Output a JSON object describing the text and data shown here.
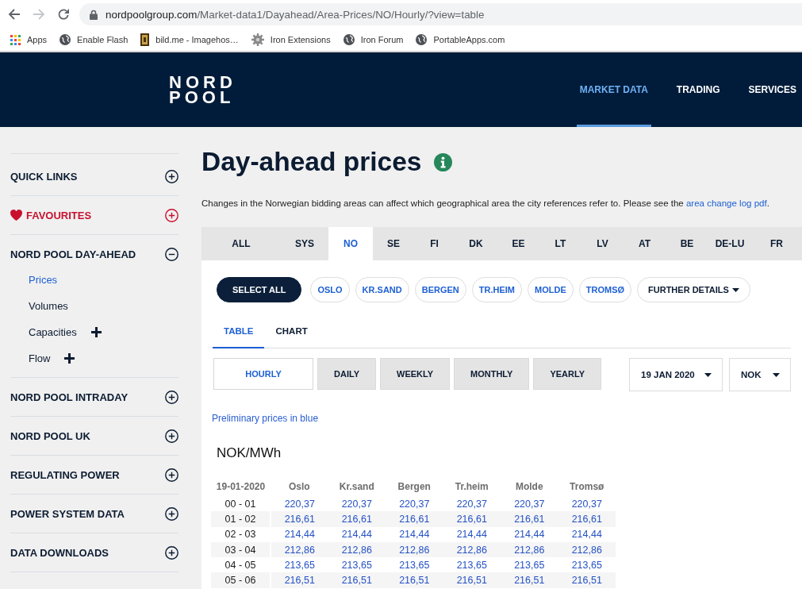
{
  "browser": {
    "nav_buttons": [
      {
        "kind": "back",
        "disabled": false
      },
      {
        "kind": "forward",
        "disabled": true
      },
      {
        "kind": "reload",
        "disabled": false
      }
    ],
    "url_host": "nordpoolgroup.com",
    "url_path": "/Market-data1/Dayahead/Area-Prices/NO/Hourly/?view=table",
    "bookmarks": [
      {
        "kind": "apps",
        "label": "Apps"
      },
      {
        "kind": "globe",
        "label": "Enable Flash"
      },
      {
        "kind": "thumbnail",
        "label": "bild.me - Imagehos…"
      },
      {
        "kind": "gear",
        "label": "Iron Extensions"
      },
      {
        "kind": "globe",
        "label": "Iron Forum"
      },
      {
        "kind": "globe",
        "label": "PortableApps.com"
      }
    ]
  },
  "header": {
    "logo": [
      "NORD",
      "POOL"
    ],
    "nav": [
      {
        "label": "MARKET DATA",
        "selected": true
      },
      {
        "label": "TRADING",
        "selected": false
      },
      {
        "label": "SERVICES",
        "selected": false
      }
    ]
  },
  "sidebar": {
    "sections": [
      {
        "label": "QUICK LINKS",
        "kind": "section",
        "expanded": false
      },
      {
        "label": "FAVOURITES",
        "kind": "favourite",
        "expanded": false
      },
      {
        "label": "NORD POOL DAY-AHEAD",
        "kind": "section",
        "expanded": true,
        "children": [
          {
            "label": "Prices",
            "selected": true,
            "expandable": false
          },
          {
            "label": "Volumes",
            "selected": false,
            "expandable": false
          },
          {
            "label": "Capacities",
            "selected": false,
            "expandable": true
          },
          {
            "label": "Flow",
            "selected": false,
            "expandable": true
          }
        ]
      },
      {
        "label": "NORD POOL INTRADAY",
        "kind": "section",
        "expanded": false
      },
      {
        "label": "NORD POOL UK",
        "kind": "section",
        "expanded": false
      },
      {
        "label": "REGULATING POWER",
        "kind": "section",
        "expanded": false
      },
      {
        "label": "POWER SYSTEM DATA",
        "kind": "section",
        "expanded": false
      },
      {
        "label": "DATA DOWNLOADS",
        "kind": "section",
        "expanded": false
      }
    ]
  },
  "page": {
    "title": "Day-ahead prices",
    "notice": {
      "text": "Changes in the Norwegian bidding areas can affect which geographical area the city references refer to. Please see the",
      "link": "area change log pdf",
      "end": "."
    }
  },
  "area_tabs": [
    {
      "label": "ALL",
      "selected": false
    },
    {
      "label": "SYS",
      "selected": false
    },
    {
      "label": "NO",
      "selected": true
    },
    {
      "label": "SE",
      "selected": false
    },
    {
      "label": "FI",
      "selected": false
    },
    {
      "label": "DK",
      "selected": false
    },
    {
      "label": "EE",
      "selected": false
    },
    {
      "label": "LT",
      "selected": false
    },
    {
      "label": "LV",
      "selected": false
    },
    {
      "label": "AT",
      "selected": false
    },
    {
      "label": "BE",
      "selected": false
    },
    {
      "label": "DE-LU",
      "selected": false
    },
    {
      "label": "FR",
      "selected": false
    }
  ],
  "city_filters": [
    {
      "label": "SELECT ALL",
      "kind": "select_all"
    },
    {
      "label": "OSLO",
      "kind": "city"
    },
    {
      "label": "KR.SAND",
      "kind": "city"
    },
    {
      "label": "BERGEN",
      "kind": "city"
    },
    {
      "label": "TR.HEIM",
      "kind": "city"
    },
    {
      "label": "MOLDE",
      "kind": "city"
    },
    {
      "label": "TROMSØ",
      "kind": "city"
    },
    {
      "label": "FURTHER DETAILS",
      "kind": "dropdown"
    }
  ],
  "view_tabs": [
    {
      "label": "TABLE",
      "selected": true
    },
    {
      "label": "CHART",
      "selected": false
    }
  ],
  "periods": [
    {
      "label": "HOURLY",
      "selected": true
    },
    {
      "label": "DAILY",
      "selected": false
    },
    {
      "label": "WEEKLY",
      "selected": false
    },
    {
      "label": "MONTHLY",
      "selected": false
    },
    {
      "label": "YEARLY",
      "selected": false
    }
  ],
  "date_select": {
    "value": "19 JAN 2020"
  },
  "currency_select": {
    "value": "NOK"
  },
  "legend_note": "Preliminary prices in blue",
  "unit": "NOK/MWh",
  "table": {
    "columns": [
      "19-01-2020",
      "Oslo",
      "Kr.sand",
      "Bergen",
      "Tr.heim",
      "Molde",
      "Tromsø"
    ],
    "rows": [
      {
        "hours": "00 - 01",
        "preliminary": true,
        "values": [
          "220,37",
          "220,37",
          "220,37",
          "220,37",
          "220,37",
          "220,37"
        ]
      },
      {
        "hours": "01 - 02",
        "preliminary": true,
        "values": [
          "216,61",
          "216,61",
          "216,61",
          "216,61",
          "216,61",
          "216,61"
        ]
      },
      {
        "hours": "02 - 03",
        "preliminary": true,
        "values": [
          "214,44",
          "214,44",
          "214,44",
          "214,44",
          "214,44",
          "214,44"
        ]
      },
      {
        "hours": "03 - 04",
        "preliminary": true,
        "values": [
          "212,86",
          "212,86",
          "212,86",
          "212,86",
          "212,86",
          "212,86"
        ]
      },
      {
        "hours": "04 - 05",
        "preliminary": true,
        "values": [
          "213,65",
          "213,65",
          "213,65",
          "213,65",
          "213,65",
          "213,65"
        ]
      },
      {
        "hours": "05 - 06",
        "preliminary": true,
        "values": [
          "216,51",
          "216,51",
          "216,51",
          "216,51",
          "216,51",
          "216,51"
        ]
      }
    ]
  }
}
